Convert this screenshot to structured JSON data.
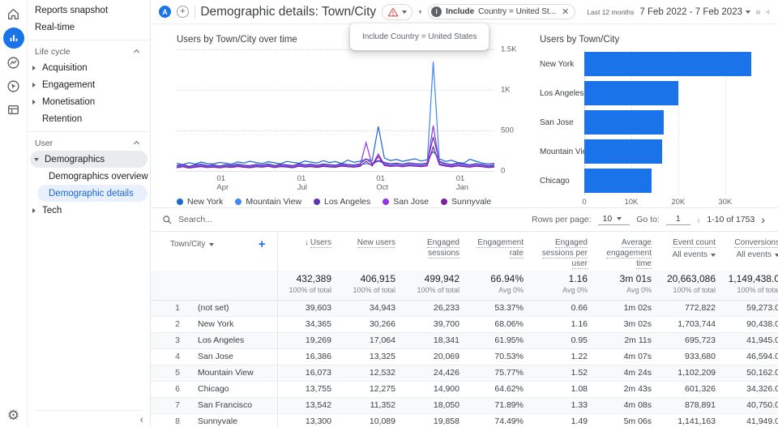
{
  "colors": {
    "accent": "#1a73e8",
    "active_link": "#1967d2",
    "warning": "#e06055",
    "bar": "#1a73e8"
  },
  "topbar": {
    "avatar_letter": "A",
    "title": "Demographic details: Town/City",
    "filter_chip": {
      "operator": "Include",
      "text": "Country = United St..."
    },
    "tooltip": "Include Country = United States",
    "date_preset": "Last 12 months",
    "date_range": "7 Feb 2022 - 7 Feb 2023"
  },
  "sidebar": {
    "reports_snapshot": "Reports snapshot",
    "real_time": "Real-time",
    "life_cycle": "Life cycle",
    "acquisition": "Acquisition",
    "engagement": "Engagement",
    "monetisation": "Monetisation",
    "retention": "Retention",
    "user": "User",
    "demographics": "Demographics",
    "demographics_overview": "Demographics overview",
    "demographic_details": "Demographic details",
    "tech": "Tech"
  },
  "chart_data": [
    {
      "type": "line",
      "title": "Users by Town/City over time",
      "ylabel": "Users",
      "ylim": [
        0,
        1500
      ],
      "y_ticks": [
        {
          "label": "1.5K",
          "value": 1500
        },
        {
          "label": "1K",
          "value": 1000
        },
        {
          "label": "500",
          "value": 500
        },
        {
          "label": "0",
          "value": 0
        }
      ],
      "x_ticks": [
        {
          "day": "01",
          "month": "Apr",
          "pos": 14.5
        },
        {
          "day": "01",
          "month": "Jul",
          "pos": 39.5
        },
        {
          "day": "01",
          "month": "Oct",
          "pos": 64.7
        },
        {
          "day": "01",
          "month": "Jan",
          "pos": 89.9
        }
      ],
      "grid": "dotted-horizontal",
      "legend_position": "bottom",
      "series": [
        {
          "name": "New York",
          "color": "#1967d2",
          "values": [
            95,
            78,
            102,
            85,
            110,
            92,
            88,
            105,
            96,
            84,
            112,
            98,
            120,
            104,
            92,
            115,
            101,
            88,
            118,
            107,
            95,
            122,
            110,
            98,
            128,
            104,
            116,
            92,
            134,
            108,
            120,
            145,
            128,
            550,
            160,
            128,
            142,
            118,
            135,
            150,
            122,
            138,
            240,
            150,
            118,
            132,
            104,
            96,
            145,
            120,
            98,
            88,
            95
          ]
        },
        {
          "name": "Mountain View",
          "color": "#4285f4",
          "values": [
            58,
            72,
            50,
            66,
            74,
            60,
            68,
            55,
            70,
            62,
            75,
            64,
            58,
            70,
            66,
            78,
            60,
            72,
            65,
            58,
            80,
            68,
            74,
            62,
            76,
            70,
            64,
            82,
            72,
            66,
            78,
            90,
            84,
            120,
            95,
            80,
            88,
            76,
            92,
            85,
            78,
            90,
            1350,
            110,
            85,
            72,
            90,
            78,
            68,
            82,
            74,
            60,
            70
          ]
        },
        {
          "name": "Los Angeles",
          "color": "#5e35b1",
          "values": [
            66,
            80,
            58,
            74,
            84,
            68,
            76,
            62,
            78,
            70,
            85,
            72,
            66,
            80,
            74,
            88,
            68,
            82,
            75,
            66,
            90,
            76,
            84,
            70,
            86,
            78,
            72,
            92,
            80,
            74,
            88,
            150,
            95,
            130,
            105,
            88,
            96,
            84,
            100,
            92,
            86,
            98,
            420,
            120,
            92,
            80,
            98,
            86,
            76,
            90,
            82,
            68,
            78
          ]
        },
        {
          "name": "San Jose",
          "color": "#9334e6",
          "values": [
            48,
            60,
            42,
            55,
            62,
            50,
            57,
            45,
            58,
            52,
            64,
            54,
            48,
            60,
            55,
            66,
            50,
            61,
            56,
            48,
            68,
            57,
            63,
            52,
            65,
            58,
            54,
            70,
            60,
            55,
            66,
            350,
            72,
            210,
            80,
            66,
            73,
            62,
            76,
            70,
            64,
            74,
            560,
            90,
            70,
            60,
            74,
            64,
            56,
            68,
            62,
            50,
            58
          ]
        },
        {
          "name": "Sunnyvale",
          "color": "#7b1fa2",
          "values": [
            40,
            52,
            36,
            46,
            54,
            42,
            48,
            38,
            50,
            44,
            55,
            46,
            40,
            52,
            47,
            57,
            42,
            53,
            48,
            40,
            58,
            48,
            54,
            44,
            56,
            50,
            46,
            60,
            52,
            47,
            56,
            120,
            62,
            180,
            68,
            56,
            62,
            52,
            65,
            60,
            54,
            63,
            300,
            76,
            60,
            50,
            63,
            54,
            47,
            58,
            52,
            42,
            49
          ]
        }
      ]
    },
    {
      "type": "bar",
      "title": "Users by Town/City",
      "orientation": "horizontal",
      "categories": [
        "New York",
        "Los Angeles",
        "San Jose",
        "Mountain View",
        "Chicago"
      ],
      "values": [
        34365,
        19269,
        16386,
        16073,
        13755
      ],
      "xlim": [
        0,
        38500
      ],
      "x_ticks": [
        {
          "label": "0",
          "value": 0
        },
        {
          "label": "10K",
          "value": 10000
        },
        {
          "label": "20K",
          "value": 20000
        },
        {
          "label": "30K",
          "value": 30000
        }
      ],
      "bar_color": "#1a73e8"
    }
  ],
  "toolbar": {
    "search_placeholder": "Search...",
    "rows_per_page_label": "Rows per page:",
    "rows_per_page_value": "10",
    "goto_label": "Go to:",
    "goto_value": "1",
    "range_text": "1-10 of 1753"
  },
  "table": {
    "dimension_header": "Town/City",
    "sort_column_index": 0,
    "columns": [
      "Users",
      "New users",
      "Engaged sessions",
      "Engagement rate",
      "Engaged sessions per user",
      "Average engagement time",
      "Event count",
      "Conversions"
    ],
    "column_subs": [
      "",
      "",
      "",
      "",
      "",
      "",
      "All events",
      "All events"
    ],
    "totals": {
      "values": [
        "432,389",
        "406,915",
        "499,942",
        "66.94%",
        "1.16",
        "3m 01s",
        "20,663,086",
        "1,149,438.0"
      ],
      "subs": [
        "100% of total",
        "100% of total",
        "100% of total",
        "Avg 0%",
        "Avg 0%",
        "Avg 0%",
        "100% of total",
        "100% of total"
      ]
    },
    "rows": [
      {
        "index": "1",
        "city": "(not set)",
        "values": [
          "39,603",
          "34,943",
          "26,233",
          "53.37%",
          "0.66",
          "1m 02s",
          "772,822",
          "59,273.0"
        ]
      },
      {
        "index": "2",
        "city": "New York",
        "values": [
          "34,365",
          "30,266",
          "39,700",
          "68.06%",
          "1.16",
          "3m 02s",
          "1,703,744",
          "90,438.0"
        ]
      },
      {
        "index": "3",
        "city": "Los Angeles",
        "values": [
          "19,269",
          "17,064",
          "18,341",
          "61.95%",
          "0.95",
          "2m 11s",
          "695,723",
          "41,945.0"
        ]
      },
      {
        "index": "4",
        "city": "San Jose",
        "values": [
          "16,386",
          "13,325",
          "20,069",
          "70.53%",
          "1.22",
          "4m 07s",
          "933,680",
          "46,594.0"
        ]
      },
      {
        "index": "5",
        "city": "Mountain View",
        "values": [
          "16,073",
          "12,532",
          "24,426",
          "75.77%",
          "1.52",
          "4m 24s",
          "1,102,209",
          "50,162.0"
        ]
      },
      {
        "index": "6",
        "city": "Chicago",
        "values": [
          "13,755",
          "12,275",
          "14,900",
          "64.62%",
          "1.08",
          "2m 43s",
          "601,326",
          "34,326.0"
        ]
      },
      {
        "index": "7",
        "city": "San Francisco",
        "values": [
          "13,542",
          "11,352",
          "18,050",
          "71.89%",
          "1.33",
          "4m 08s",
          "878,891",
          "40,750.0"
        ]
      },
      {
        "index": "8",
        "city": "Sunnyvale",
        "values": [
          "13,300",
          "10,089",
          "19,858",
          "74.49%",
          "1.49",
          "5m 06s",
          "1,141,163",
          "41,949.0"
        ]
      }
    ]
  }
}
